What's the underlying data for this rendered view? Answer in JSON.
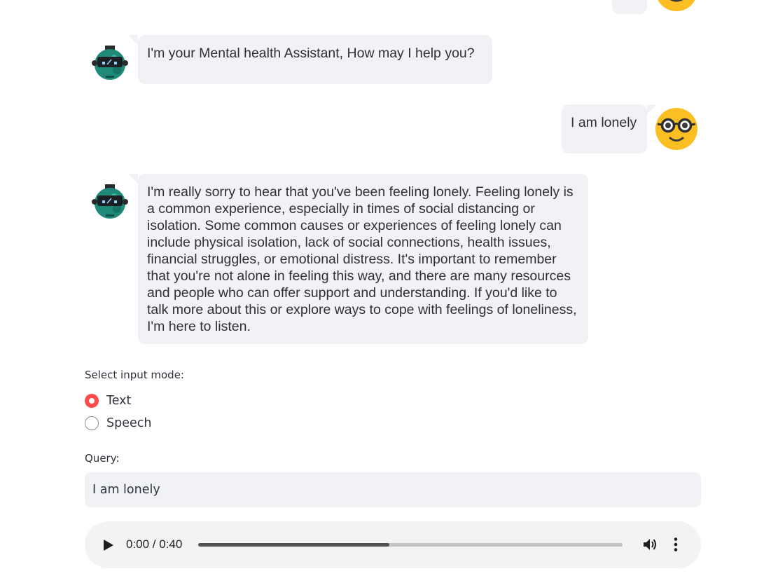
{
  "messages": [
    {
      "role": "assistant",
      "text": "I'm your Mental health Assistant, How may I help you?"
    },
    {
      "role": "user",
      "text": "I am lonely"
    },
    {
      "role": "assistant",
      "text": "I'm really sorry to hear that you've been feeling lonely. Feeling lonely is a common experience, especially in times of social distancing or isolation. Some common causes or experiences of feeling lonely can include physical isolation, lack of social connections, health issues, financial struggles, or emotional distress. It's important to remember that you're not alone in feeling this way, and there are many resources and people who can offer support and understanding. If you'd like to talk more about this or explore ways to cope with feelings of loneliness, I'm here to listen."
    }
  ],
  "input_mode": {
    "label": "Select input mode:",
    "options": [
      "Text",
      "Speech"
    ],
    "selected": "Text"
  },
  "query": {
    "label": "Query:",
    "value": "I am lonely"
  },
  "audio": {
    "time": "0:00 / 0:40",
    "progress_fraction": 0.45
  },
  "colors": {
    "accent": "#ff4b4b",
    "bubble": "#f0f2f6",
    "bot_avatar": "#1f8a7a",
    "user_avatar": "#fbbf24"
  },
  "icons": {
    "bot": "robot-avatar-icon",
    "user": "nerd-face-avatar-icon",
    "play": "play-icon",
    "volume": "volume-icon",
    "menu": "more-vertical-icon"
  }
}
